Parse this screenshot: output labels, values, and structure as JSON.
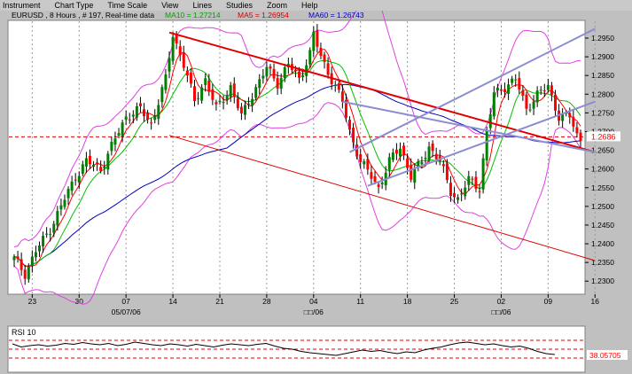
{
  "menu": [
    "Instrument",
    "Chart Type",
    "Time Scale",
    "View",
    "Lines",
    "Studies",
    "Zoom",
    "Help"
  ],
  "header": {
    "info": "EURUSD , 8 Hours , # 197, Real-time data",
    "ma10": "MA10 = 1.27214",
    "ma5": "MA5 = 1.26954",
    "ma60": "MA60 = 1.26743"
  },
  "colors": {
    "background": "#c0c0c0",
    "plot_bg": "#ffffff",
    "candle_up": "#008000",
    "candle_down": "#ff0000",
    "wick": "#000000",
    "ma10": "#00c000",
    "ma5": "#ff0000",
    "ma60": "#0000c0",
    "bollinger": "#e040e0",
    "trend_red": "#e00000",
    "channel_blue": "#8c8cd2",
    "dashed_ref": "#e00000",
    "price_tag": "#ff0000"
  },
  "chart_data": {
    "type": "candlestick",
    "symbol": "EURUSD",
    "timeframe": "8 Hours",
    "y_ticks": [
      "1.2950",
      "1.2900",
      "1.2850",
      "1.2800",
      "1.2750",
      "1.2700",
      "1.2650",
      "1.2600",
      "1.2550",
      "1.2500",
      "1.2450",
      "1.2400",
      "1.2350",
      "1.2300"
    ],
    "y_tick_values": [
      1.295,
      1.29,
      1.285,
      1.28,
      1.275,
      1.27,
      1.265,
      1.26,
      1.255,
      1.25,
      1.245,
      1.24,
      1.235,
      1.23
    ],
    "ylim": [
      1.2265,
      1.2995
    ],
    "x_ticks": [
      {
        "label": "23",
        "bar": 5
      },
      {
        "label": "30",
        "bar": 18
      },
      {
        "label": "07",
        "bar": 31
      },
      {
        "label": "14",
        "bar": 44
      },
      {
        "label": "21",
        "bar": 57
      },
      {
        "label": "28",
        "bar": 70
      },
      {
        "label": "04",
        "bar": 83
      },
      {
        "label": "11",
        "bar": 96
      },
      {
        "label": "18",
        "bar": 109
      },
      {
        "label": "25",
        "bar": 122
      },
      {
        "label": "02",
        "bar": 135
      },
      {
        "label": "09",
        "bar": 148
      },
      {
        "label": "16",
        "bar": 161
      }
    ],
    "x_sublabels": [
      {
        "label": "05/07/06",
        "bar": 31
      },
      {
        "label": "□□/06",
        "bar": 83
      },
      {
        "label": "□□/06",
        "bar": 135
      }
    ],
    "close_path": [
      [
        0,
        1.236
      ],
      [
        3,
        1.232
      ],
      [
        6,
        1.238
      ],
      [
        10,
        1.244
      ],
      [
        14,
        1.252
      ],
      [
        17,
        1.258
      ],
      [
        20,
        1.262
      ],
      [
        24,
        1.26
      ],
      [
        27,
        1.266
      ],
      [
        31,
        1.274
      ],
      [
        35,
        1.276
      ],
      [
        38,
        1.272
      ],
      [
        42,
        1.284
      ],
      [
        44,
        1.296
      ],
      [
        47,
        1.288
      ],
      [
        50,
        1.278
      ],
      [
        53,
        1.284
      ],
      [
        56,
        1.276
      ],
      [
        60,
        1.282
      ],
      [
        63,
        1.274
      ],
      [
        66,
        1.28
      ],
      [
        70,
        1.287
      ],
      [
        73,
        1.283
      ],
      [
        76,
        1.288
      ],
      [
        79,
        1.284
      ],
      [
        82,
        1.291
      ],
      [
        83,
        1.296
      ],
      [
        85,
        1.29
      ],
      [
        88,
        1.284
      ],
      [
        91,
        1.278
      ],
      [
        93,
        1.27
      ],
      [
        96,
        1.262
      ],
      [
        99,
        1.258
      ],
      [
        101,
        1.255
      ],
      [
        104,
        1.262
      ],
      [
        107,
        1.266
      ],
      [
        110,
        1.258
      ],
      [
        113,
        1.262
      ],
      [
        115,
        1.266
      ],
      [
        118,
        1.262
      ],
      [
        121,
        1.254
      ],
      [
        123,
        1.252
      ],
      [
        126,
        1.257
      ],
      [
        129,
        1.255
      ],
      [
        131,
        1.27
      ],
      [
        133,
        1.28
      ],
      [
        136,
        1.282
      ],
      [
        139,
        1.284
      ],
      [
        142,
        1.276
      ],
      [
        145,
        1.28
      ],
      [
        148,
        1.282
      ],
      [
        151,
        1.274
      ],
      [
        154,
        1.274
      ],
      [
        156,
        1.269
      ],
      [
        158,
        1.267
      ]
    ],
    "last_price": "1.2686",
    "last_price_value": 1.2686,
    "dashed_reference": 1.2686,
    "trendlines": [
      {
        "from": [
          43,
          1.2965
        ],
        "to": [
          161,
          1.2645
        ],
        "color": "red",
        "width": 2
      },
      {
        "from": [
          43,
          1.269
        ],
        "to": [
          161,
          1.2355
        ],
        "color": "red",
        "width": 1
      },
      {
        "from": [
          93,
          1.2645
        ],
        "to": [
          161,
          1.2975
        ],
        "color": "blue"
      },
      {
        "from": [
          98,
          1.2555
        ],
        "to": [
          161,
          1.278
        ],
        "color": "blue"
      },
      {
        "from": [
          91,
          1.278
        ],
        "to": [
          161,
          1.2645
        ],
        "color": "blue"
      }
    ]
  },
  "rsi": {
    "label": "RSI 10",
    "value": "38.05705",
    "levels": [
      70,
      50,
      30
    ],
    "ylim": [
      0,
      100
    ],
    "values": [
      62,
      55,
      58,
      60,
      57,
      59,
      63,
      61,
      65,
      62,
      60,
      63,
      58,
      61,
      66,
      63,
      60,
      58,
      62,
      60,
      57,
      61,
      58,
      55,
      59,
      62,
      60,
      58,
      61,
      63,
      57,
      52,
      50,
      45,
      42,
      40,
      38,
      36,
      40,
      44,
      48,
      45,
      47,
      43,
      40,
      44,
      42,
      48,
      52,
      55,
      60,
      64,
      66,
      63,
      60,
      62,
      58,
      55,
      57,
      52,
      45,
      40,
      38
    ]
  }
}
